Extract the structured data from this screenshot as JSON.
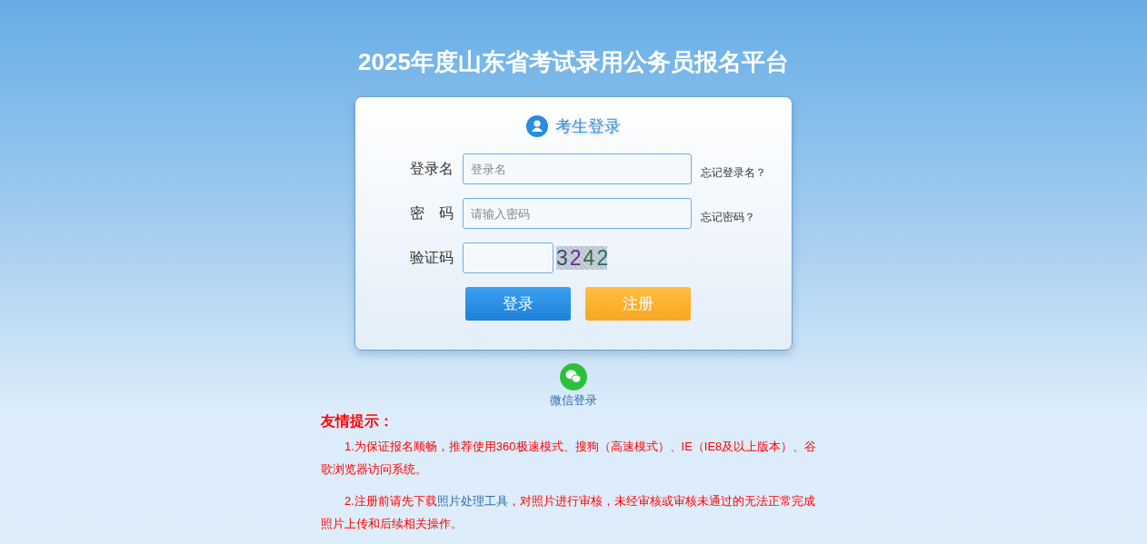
{
  "title": "2025年度山东省考试录用公务员报名平台",
  "login": {
    "heading": "考生登录",
    "fields": [
      {
        "label": "登录名",
        "placeholder": "登录名",
        "link": "忘记登录名？",
        "kind": "text"
      },
      {
        "label": "密　码",
        "placeholder": "请输入密码",
        "link": "忘记密码？",
        "kind": "password"
      },
      {
        "label": "验证码",
        "captcha": "3242",
        "kind": "captcha"
      }
    ],
    "buttons": [
      {
        "label": "登录",
        "kind": "primary"
      },
      {
        "label": "注册",
        "kind": "secondary"
      }
    ]
  },
  "wechat": {
    "label": "微信登录"
  },
  "tips": {
    "heading": "友情提示：",
    "items": [
      {
        "text": "1.为保证报名顺畅，推荐使用360极速模式、搜狗（高速模式）、IE（IE8及以上版本）、谷歌浏览器访问系统。"
      },
      {
        "before": "2.注册前请先下载",
        "link": "照片处理工具",
        "after": "，对照片进行审核，未经审核或审核未通过的无法正常完成照片上传和后续相关操作。"
      }
    ]
  }
}
